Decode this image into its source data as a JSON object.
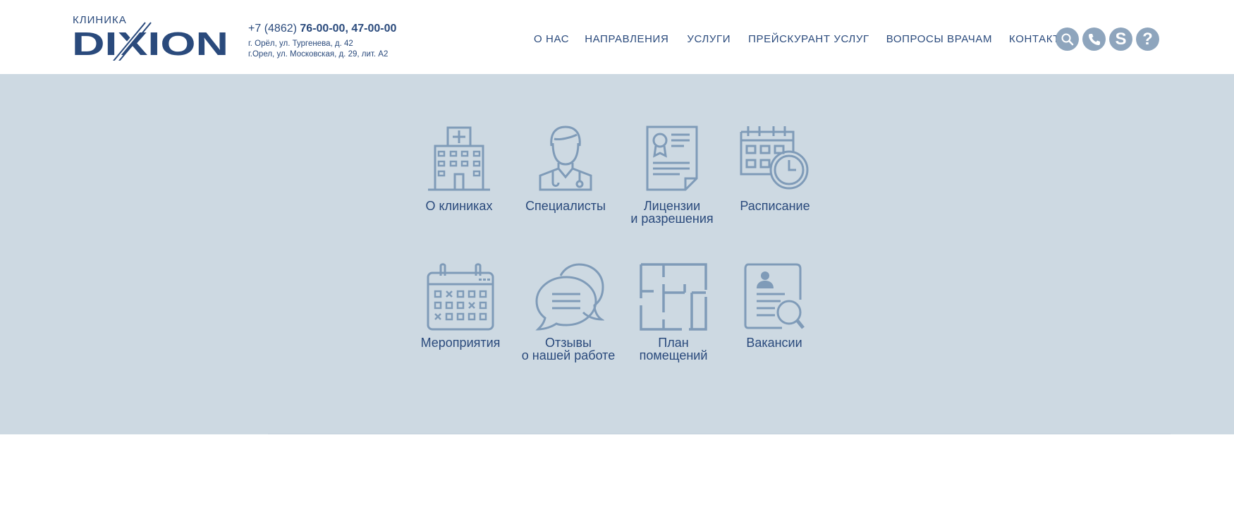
{
  "brand": {
    "clinic_word": "КЛИНИКА",
    "name": "DIXION",
    "color": "#2a4a7c"
  },
  "contacts": {
    "phone_prefix": "+7 (4862) ",
    "phone_numbers": "76-00-00, 47-00-00",
    "address_1": "г. Орёл, ул. Тургенева, д. 42",
    "address_2": "г.Орел, ул. Московская, д. 29, лит. А2"
  },
  "nav": {
    "items": [
      "О НАС",
      "НАПРАВЛЕНИЯ",
      "УСЛУГИ",
      "ПРЕЙСКУРАНТ УСЛУГ",
      "ВОПРОСЫ ВРАЧАМ",
      "КОНТАКТЫ"
    ]
  },
  "tools": {
    "icons": [
      "search-icon",
      "phone-icon",
      "skype-icon",
      "help-icon"
    ]
  },
  "tiles": [
    {
      "icon": "hospital-icon",
      "line1": "О клиниках",
      "line2": ""
    },
    {
      "icon": "doctor-icon",
      "line1": "Специалисты",
      "line2": ""
    },
    {
      "icon": "certificate-icon",
      "line1": "Лицензии",
      "line2": "и разрешения"
    },
    {
      "icon": "calendar-clock-icon",
      "line1": "Расписание",
      "line2": ""
    },
    {
      "icon": "events-calendar-icon",
      "line1": "Мероприятия",
      "line2": ""
    },
    {
      "icon": "chat-bubbles-icon",
      "line1": "Отзывы",
      "line2": "о нашей работе"
    },
    {
      "icon": "floor-plan-icon",
      "line1": "План",
      "line2": "помещений"
    },
    {
      "icon": "vacancy-search-icon",
      "line1": "Вакансии",
      "line2": ""
    }
  ],
  "colors": {
    "band": "#cdd9e2",
    "icon": "#7f9bb8",
    "text": "#2a4a7c"
  }
}
